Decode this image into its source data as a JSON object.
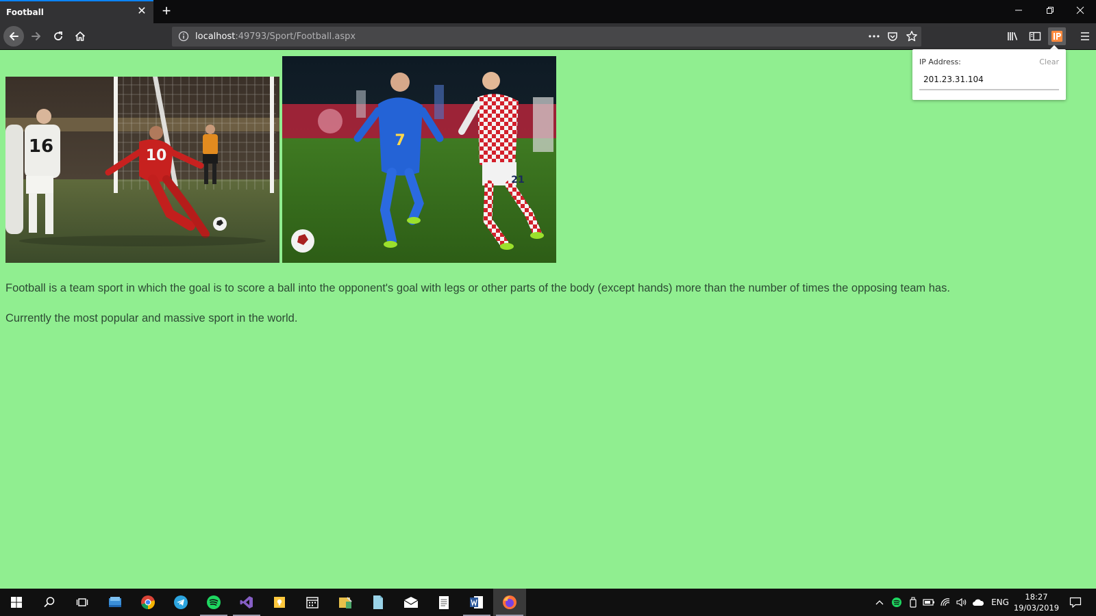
{
  "browser": {
    "tab_title": "Football",
    "close_glyph": "✕",
    "new_tab_glyph": "+",
    "url_host": "localhost",
    "url_rest": ":49793/Sport/Football.aspx",
    "accent_color": "#0a84ff"
  },
  "ip_popup": {
    "label": "IP Address:",
    "clear_label": "Clear",
    "value": "201.23.31.104"
  },
  "page": {
    "background": "#90ee90",
    "paragraph1": "Football is a team sport in which the goal is to score a ball into the opponent's goal with legs or other parts of the body (except hands) more than the number of times the opposing team has.",
    "paragraph2": "Currently the most popular and massive sport in the world.",
    "photo1": {
      "jersey_left": "16",
      "jersey_right": "10"
    },
    "photo2": {
      "jersey_left": "7",
      "jersey_right": "21"
    }
  },
  "taskbar": {
    "language": "ENG",
    "time": "18:27",
    "date": "19/03/2019"
  }
}
